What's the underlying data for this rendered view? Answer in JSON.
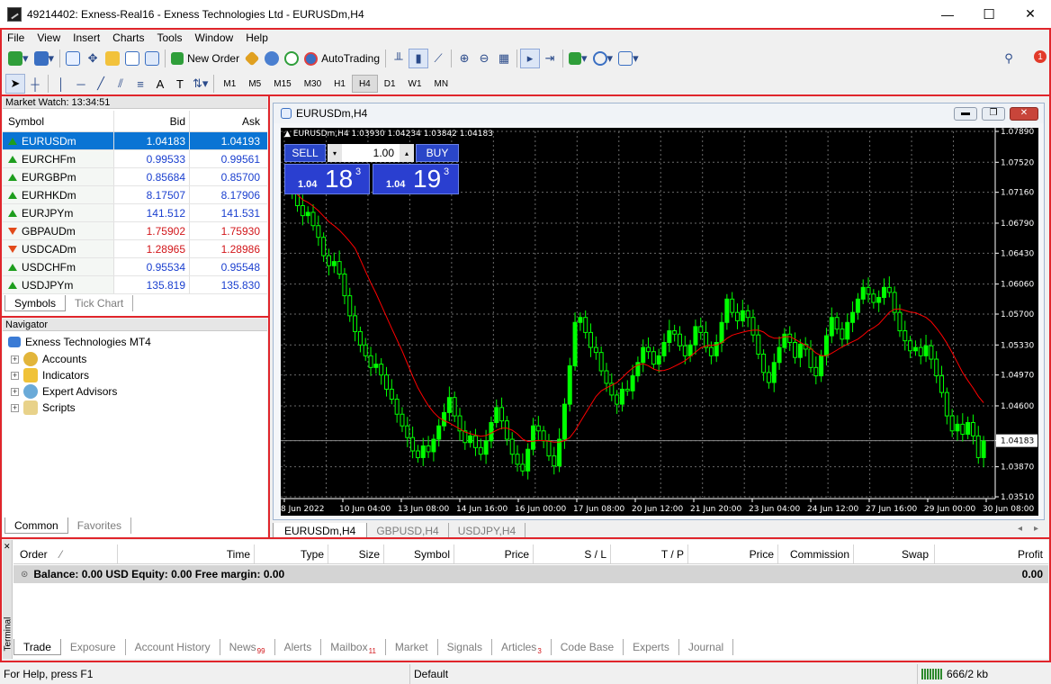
{
  "window": {
    "title": "49214402: Exness-Real16 - Exness Technologies Ltd - EURUSDm,H4",
    "minimize": "—",
    "maximize": "☐",
    "close": "✕"
  },
  "menu": [
    "File",
    "View",
    "Insert",
    "Charts",
    "Tools",
    "Window",
    "Help"
  ],
  "toolbar": {
    "new_order": "New Order",
    "autotrading": "AutoTrading",
    "notification_count": "1"
  },
  "timeframes": [
    "M1",
    "M5",
    "M15",
    "M30",
    "H1",
    "H4",
    "D1",
    "W1",
    "MN"
  ],
  "active_timeframe": "H4",
  "market_watch": {
    "title": "Market Watch: 13:34:51",
    "columns": [
      "Symbol",
      "Bid",
      "Ask"
    ],
    "rows": [
      {
        "symbol": "EURUSDm",
        "bid": "1.04183",
        "ask": "1.04193",
        "dir": "up",
        "color": "blue",
        "selected": true
      },
      {
        "symbol": "EURCHFm",
        "bid": "0.99533",
        "ask": "0.99561",
        "dir": "up",
        "color": "blue"
      },
      {
        "symbol": "EURGBPm",
        "bid": "0.85684",
        "ask": "0.85700",
        "dir": "up",
        "color": "blue"
      },
      {
        "symbol": "EURHKDm",
        "bid": "8.17507",
        "ask": "8.17906",
        "dir": "up",
        "color": "blue"
      },
      {
        "symbol": "EURJPYm",
        "bid": "141.512",
        "ask": "141.531",
        "dir": "up",
        "color": "blue"
      },
      {
        "symbol": "GBPAUDm",
        "bid": "1.75902",
        "ask": "1.75930",
        "dir": "down",
        "color": "red"
      },
      {
        "symbol": "USDCADm",
        "bid": "1.28965",
        "ask": "1.28986",
        "dir": "down",
        "color": "red"
      },
      {
        "symbol": "USDCHFm",
        "bid": "0.95534",
        "ask": "0.95548",
        "dir": "up",
        "color": "blue"
      },
      {
        "symbol": "USDJPYm",
        "bid": "135.819",
        "ask": "135.830",
        "dir": "up",
        "color": "blue"
      }
    ],
    "tabs": [
      "Symbols",
      "Tick Chart"
    ]
  },
  "navigator": {
    "title": "Navigator",
    "root": "Exness Technologies MT4",
    "items": [
      "Accounts",
      "Indicators",
      "Expert Advisors",
      "Scripts"
    ],
    "tabs": [
      "Common",
      "Favorites"
    ]
  },
  "chart_window": {
    "title": "EURUSDm,H4",
    "ohlc_label": "EURUSDm,H4  1.03930 1.04234 1.03842 1.04183",
    "sell": "SELL",
    "buy": "BUY",
    "volume": "1.00",
    "sell_price_small": "1.04",
    "sell_price_big": "18",
    "sell_price_sup": "3",
    "buy_price_small": "1.04",
    "buy_price_big": "19",
    "buy_price_sup": "3",
    "current_price": "1.04183",
    "tabs": [
      "EURUSDm,H4",
      "GBPUSD,H4",
      "USDJPY,H4"
    ]
  },
  "chart_data": {
    "type": "candlestick",
    "symbol": "EURUSDm",
    "timeframe": "H4",
    "ylim": [
      1.0351,
      1.0789
    ],
    "y_ticks": [
      "1.07890",
      "1.07520",
      "1.07160",
      "1.06790",
      "1.06430",
      "1.06060",
      "1.05700",
      "1.05330",
      "1.04970",
      "1.04600",
      "1.04183",
      "1.03870",
      "1.03510"
    ],
    "x_ticks": [
      "8 Jun 2022",
      "10 Jun 04:00",
      "13 Jun 08:00",
      "14 Jun 16:00",
      "16 Jun 00:00",
      "17 Jun 08:00",
      "20 Jun 12:00",
      "21 Jun 20:00",
      "23 Jun 04:00",
      "24 Jun 12:00",
      "27 Jun 16:00",
      "29 Jun 00:00",
      "30 Jun 08:00"
    ],
    "grid": true,
    "current_price": 1.04183,
    "colors": {
      "background": "#000000",
      "bull": "#00ff00",
      "bear": "#000000",
      "wick": "#00ff00",
      "ma": "#ff0000",
      "grid": "#6a6a6a"
    },
    "closes": [
      1.0722,
      1.0718,
      1.07,
      1.0688,
      1.0692,
      1.0676,
      1.0662,
      1.064,
      1.0628,
      1.0633,
      1.0618,
      1.0592,
      1.0568,
      1.0549,
      1.0533,
      1.052,
      1.0506,
      1.051,
      1.0497,
      1.048,
      1.0468,
      1.045,
      1.0436,
      1.0422,
      1.0406,
      1.0398,
      1.0412,
      1.0405,
      1.042,
      1.0436,
      1.0452,
      1.047,
      1.0448,
      1.043,
      1.0416,
      1.0424,
      1.041,
      1.0402,
      1.0418,
      1.044,
      1.0458,
      1.0442,
      1.042,
      1.0402,
      1.039,
      1.0382,
      1.0408,
      1.0436,
      1.043,
      1.0418,
      1.04,
      1.0388,
      1.042,
      1.0462,
      1.0508,
      1.056,
      1.0566,
      1.0548,
      1.053,
      1.0524,
      1.0502,
      1.0487,
      1.0473,
      1.0462,
      1.048,
      1.0478,
      1.0496,
      1.0512,
      1.053,
      1.0525,
      1.051,
      1.052,
      1.0536,
      1.055,
      1.0546,
      1.0532,
      1.052,
      1.0533,
      1.0555,
      1.0548,
      1.053,
      1.052,
      1.0536,
      1.056,
      1.0588,
      1.0572,
      1.0562,
      1.0574,
      1.0566,
      1.0545,
      1.0522,
      1.05,
      1.0488,
      1.0512,
      1.053,
      1.0546,
      1.0536,
      1.0518,
      1.0534,
      1.0528,
      1.0506,
      1.0496,
      1.052,
      1.0544,
      1.0566,
      1.0552,
      1.054,
      1.056,
      1.0572,
      1.0588,
      1.0602,
      1.0594,
      1.0584,
      1.059,
      1.0602,
      1.0596,
      1.0572,
      1.055,
      1.0538,
      1.0526,
      1.053,
      1.052,
      1.0532,
      1.0516,
      1.0496,
      1.0476,
      1.0448,
      1.043,
      1.0438,
      1.0426,
      1.044,
      1.0424,
      1.0398,
      1.0418
    ]
  },
  "terminal": {
    "side_label": "Terminal",
    "columns": [
      "Order",
      "Time",
      "Type",
      "Size",
      "Symbol",
      "Price",
      "S / L",
      "T / P",
      "Price",
      "Commission",
      "Swap",
      "Profit"
    ],
    "balance_line": "Balance: 0.00 USD  Equity: 0.00  Free margin: 0.00",
    "profit": "0.00",
    "tabs": [
      {
        "label": "Trade",
        "badge": ""
      },
      {
        "label": "Exposure",
        "badge": ""
      },
      {
        "label": "Account History",
        "badge": ""
      },
      {
        "label": "News",
        "badge": "99"
      },
      {
        "label": "Alerts",
        "badge": ""
      },
      {
        "label": "Mailbox",
        "badge": "11"
      },
      {
        "label": "Market",
        "badge": ""
      },
      {
        "label": "Signals",
        "badge": ""
      },
      {
        "label": "Articles",
        "badge": "3"
      },
      {
        "label": "Code Base",
        "badge": ""
      },
      {
        "label": "Experts",
        "badge": ""
      },
      {
        "label": "Journal",
        "badge": ""
      }
    ]
  },
  "status": {
    "help": "For Help, press F1",
    "profile": "Default",
    "traffic": "666/2 kb"
  }
}
